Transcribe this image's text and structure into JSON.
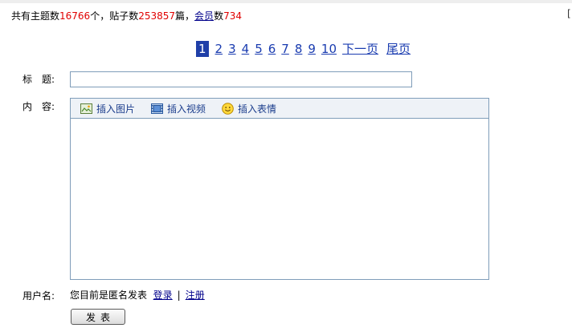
{
  "stats": {
    "prefix_topics": "共有主题数",
    "topics_count": "16766",
    "unit_topics": "个，贴子数",
    "posts_count": "253857",
    "unit_posts": "篇，",
    "members_link": "会员",
    "members_label": "数",
    "members_count": "734"
  },
  "edge_glyph": "[",
  "pager": {
    "pages": [
      "1",
      "2",
      "3",
      "4",
      "5",
      "6",
      "7",
      "8",
      "9",
      "10"
    ],
    "current": "1",
    "next": "下一页",
    "last": "尾页"
  },
  "form": {
    "title_label": "标　题:",
    "content_label": "内　容:",
    "user_label": "用户名:",
    "title_value": "",
    "content_value": ""
  },
  "toolbar": {
    "insert_image": "插入图片",
    "insert_video": "插入视频",
    "insert_emoticon": "插入表情"
  },
  "user": {
    "anon_text": "您目前是匿名发表",
    "login": "登录",
    "separator": "|",
    "register": "注册"
  },
  "submit_label": "发表"
}
